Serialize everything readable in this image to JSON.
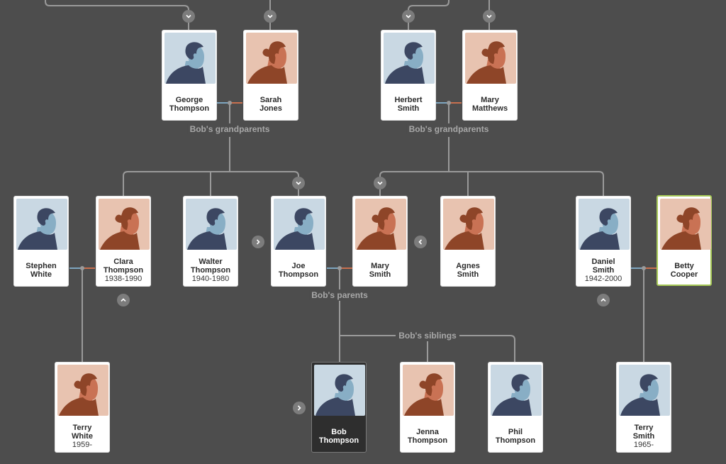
{
  "colors": {
    "background": "#4d4d4d",
    "connector": "#9a9a9a",
    "male_link": "#7ea6c0",
    "female_link": "#c9704e",
    "selected_border": "#a7c957",
    "focus_card": "#2e2e2e"
  },
  "people": {
    "george": {
      "name1": "George",
      "name2": "Thompson",
      "years": "",
      "gender": "male"
    },
    "sarah": {
      "name1": "Sarah",
      "name2": "Jones",
      "years": "",
      "gender": "female"
    },
    "herbert": {
      "name1": "Herbert",
      "name2": "Smith",
      "years": "",
      "gender": "male"
    },
    "mary_m": {
      "name1": "Mary",
      "name2": "Matthews",
      "years": "",
      "gender": "female"
    },
    "stephen": {
      "name1": "Stephen",
      "name2": "White",
      "years": "",
      "gender": "male"
    },
    "clara": {
      "name1": "Clara",
      "name2": "Thompson",
      "years": "1938-1990",
      "gender": "female"
    },
    "walter": {
      "name1": "Walter",
      "name2": "Thompson",
      "years": "1940-1980",
      "gender": "male"
    },
    "joe": {
      "name1": "Joe",
      "name2": "Thompson",
      "years": "",
      "gender": "male"
    },
    "mary_s": {
      "name1": "Mary",
      "name2": "Smith",
      "years": "",
      "gender": "female"
    },
    "agnes": {
      "name1": "Agnes",
      "name2": "Smith",
      "years": "",
      "gender": "female"
    },
    "daniel": {
      "name1": "Daniel",
      "name2": "Smith",
      "years": "1942-2000",
      "gender": "male"
    },
    "betty": {
      "name1": "Betty",
      "name2": "Cooper",
      "years": "",
      "gender": "female"
    },
    "terry_w": {
      "name1": "Terry",
      "name2": "White",
      "years": "1959-",
      "gender": "female"
    },
    "bob": {
      "name1": "Bob",
      "name2": "Thompson",
      "years": "",
      "gender": "male"
    },
    "jenna": {
      "name1": "Jenna",
      "name2": "Thompson",
      "years": "",
      "gender": "female"
    },
    "phil": {
      "name1": "Phil",
      "name2": "Thompson",
      "years": "",
      "gender": "male"
    },
    "terry_s": {
      "name1": "Terry",
      "name2": "Smith",
      "years": "1965-",
      "gender": "male"
    }
  },
  "labels": {
    "grandparents_paternal": "Bob's grandparents",
    "grandparents_maternal": "Bob's grandparents",
    "parents": "Bob's parents",
    "siblings": "Bob's siblings"
  },
  "focus_person": "bob",
  "selected_person": "betty"
}
